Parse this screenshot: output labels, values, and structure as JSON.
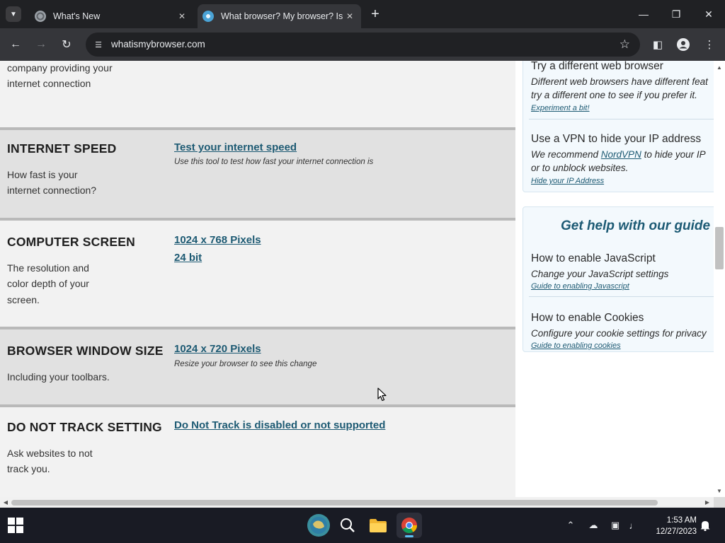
{
  "tabs": [
    {
      "label": "What's New",
      "active": false
    },
    {
      "label": "What browser? My browser? Is",
      "active": true
    }
  ],
  "toolbar": {
    "url": "whatismybrowser.com"
  },
  "rows": [
    {
      "key": "isp",
      "title": "",
      "description": "company providing your internet connection",
      "value": "",
      "value2": "",
      "note": ""
    },
    {
      "key": "internet-speed",
      "title": "INTERNET SPEED",
      "description": "How fast is your internet connection?",
      "value": "Test your internet speed",
      "value2": "",
      "note": "Use this tool to test how fast your internet connection is"
    },
    {
      "key": "computer-screen",
      "title": "COMPUTER SCREEN",
      "description": "The resolution and color depth of your screen.",
      "value": "1024 x 768 Pixels",
      "value2": "24 bit",
      "note": ""
    },
    {
      "key": "browser-window-size",
      "title": "BROWSER WINDOW SIZE",
      "description": "Including your toolbars.",
      "value": "1024 x 720 Pixels",
      "value2": "",
      "note": "Resize your browser to see this change"
    },
    {
      "key": "do-not-track",
      "title": "DO NOT TRACK SETTING",
      "description": "Ask websites to not track you.",
      "value": "Do Not Track is disabled or not supported",
      "value2": "",
      "note": ""
    }
  ],
  "sidebar": {
    "card1": {
      "items": [
        {
          "title": "Try a different web browser",
          "desc_line1": "Different web browsers have different feat",
          "desc_line2": "try a different one to see if you prefer it.",
          "link": "Experiment a bit!"
        },
        {
          "title": "Use a VPN to hide your IP address",
          "desc_pre": "We recommend ",
          "desc_link": "NordVPN",
          "desc_post": " to hide your IP",
          "desc_line2": "or to unblock websites.",
          "link": "Hide your IP Address"
        }
      ]
    },
    "card2": {
      "heading": "Get help with our guide",
      "items": [
        {
          "title": "How to enable JavaScript",
          "desc": "Change your JavaScript settings",
          "link": "Guide to enabling Javascript"
        },
        {
          "title": "How to enable Cookies",
          "desc": "Configure your cookie settings for privacy",
          "link": "Guide to enabling cookies"
        }
      ]
    }
  },
  "taskbar": {
    "time": "1:53 AM",
    "date": "12/27/2023"
  },
  "colors": {
    "link": "#1d5a73",
    "row_light": "#f2f2f2",
    "row_dark": "#e1e1e1",
    "chrome_dark": "#202124",
    "toolbar": "#35363a",
    "taskbar": "#191b24"
  }
}
